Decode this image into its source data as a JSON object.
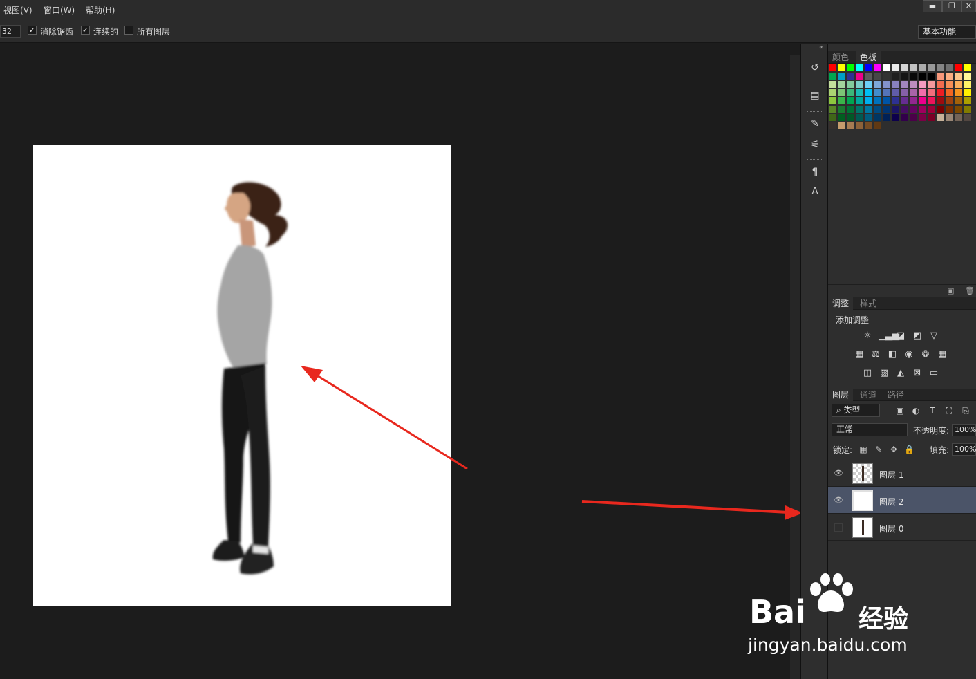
{
  "menu": [
    "视图(V)",
    "窗口(W)",
    "帮助(H)"
  ],
  "window_controls": {
    "minimize": "▬",
    "restore": "❐",
    "close": "✕"
  },
  "options": {
    "tolerance": "32",
    "anti_alias": {
      "label": "消除锯齿",
      "checked": true
    },
    "contiguous": {
      "label": "连续的",
      "checked": true
    },
    "all_layers": {
      "label": "所有图层",
      "checked": false
    },
    "workspace": "基本功能"
  },
  "collapse_arrows": "«",
  "swatch_panel": {
    "tabs": [
      "颜色",
      "色板"
    ],
    "active_tab": "色板",
    "colors": {
      "row1": [
        "#ff0000",
        "#ffff00",
        "#00ff00",
        "#00ffff",
        "#0000ff",
        "#ff00ff",
        "#ffffff",
        "#ebebeb",
        "#d6d6d6",
        "#c2c2c2",
        "#adadad",
        "#999999",
        "#858585",
        "#707070",
        "#ff0000",
        "#ffff00"
      ],
      "row2": [
        "#00a650",
        "#00a0c6",
        "#2e3192",
        "#ec008c",
        "#5c5c5c",
        "#474747",
        "#333333",
        "#1f1f1f",
        "#141414",
        "#0a0a0a",
        "#000000",
        "#000000",
        "#f7977a",
        "#fbad82",
        "#fdc68c",
        "#fff799"
      ],
      "row3": [
        "#c4df9b",
        "#a3d39c",
        "#82ca9c",
        "#7accc8",
        "#6dcff6",
        "#7da7d8",
        "#8393ca",
        "#8882be",
        "#a187be",
        "#bc8dbf",
        "#f49ac1",
        "#f5989d",
        "#f26c4f",
        "#f68e56",
        "#fbaf5c",
        "#fff467"
      ],
      "row4": [
        "#acd372",
        "#7cc576",
        "#3bb878",
        "#1abbb4",
        "#00bff3",
        "#438ccb",
        "#5574b9",
        "#605ca8",
        "#8560a8",
        "#a864a8",
        "#f06eaa",
        "#f26d7d",
        "#ed1c24",
        "#f26522",
        "#f7941d",
        "#fff200"
      ],
      "row5": [
        "#8dc63f",
        "#39b54a",
        "#00a651",
        "#00a99d",
        "#00aeef",
        "#0072bc",
        "#0054a6",
        "#2e3192",
        "#662d91",
        "#92278f",
        "#ec008c",
        "#ed145b",
        "#9e0b0f",
        "#a0410d",
        "#a36209",
        "#aba000"
      ],
      "row6": [
        "#598527",
        "#197b30",
        "#007236",
        "#00746b",
        "#0076a3",
        "#004a80",
        "#003471",
        "#1b1464",
        "#440e62",
        "#630460",
        "#9e005d",
        "#9e0039",
        "#790000",
        "#7b2e00",
        "#7d4900",
        "#827b00"
      ],
      "row7": [
        "#406618",
        "#005e20",
        "#005826",
        "#005952",
        "#005b7f",
        "#003663",
        "#002157",
        "#0d004c",
        "#32004b",
        "#4b0049",
        "#7b0046",
        "#7a0026",
        "#c7b299",
        "#998675",
        "#736357",
        "#534741"
      ],
      "row8": [
        "#37302d",
        "#c69c6d",
        "#a67c52",
        "#8c6239",
        "#754c24",
        "#603913"
      ]
    }
  },
  "adjustments": {
    "tabs": [
      "调整",
      "样式"
    ],
    "title": "添加调整",
    "icons": [
      [
        "brightness-icon",
        "levels-icon",
        "curves-icon",
        "exposure-icon",
        "vibrance-icon"
      ],
      [
        "hue-icon",
        "color-balance-icon",
        "black-white-icon",
        "photo-filter-icon",
        "channel-mixer-icon",
        "color-lookup-icon"
      ],
      [
        "invert-icon",
        "posterize-icon",
        "threshold-icon",
        "selective-color-icon",
        "gradient-map-icon"
      ]
    ]
  },
  "layers_panel": {
    "tabs": [
      "图层",
      "通道",
      "路径"
    ],
    "filter_kind": "类型",
    "blend_mode": "正常",
    "opacity_label": "不透明度:",
    "opacity_value": "100%",
    "lock_label": "锁定:",
    "fill_label": "填充:",
    "fill_value": "100%",
    "layers": [
      {
        "name": "图层 1",
        "visible": true,
        "selected": false
      },
      {
        "name": "图层 2",
        "visible": true,
        "selected": true
      },
      {
        "name": "图层 0",
        "visible": false,
        "selected": false
      }
    ]
  },
  "watermark": {
    "brand": "Bai",
    "brand_suffix": "经验",
    "url": "jingyan.baidu.com"
  },
  "colors": {
    "annotation_arrow": "#e8281e",
    "selected_layer": "#4b5468"
  }
}
